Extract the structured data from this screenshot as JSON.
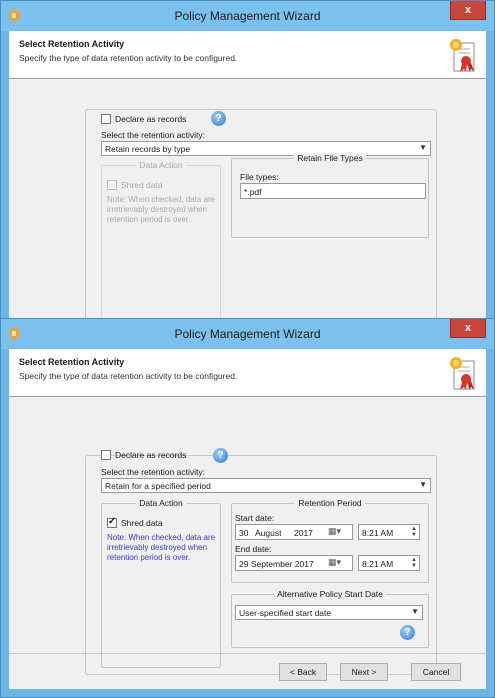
{
  "window1": {
    "title": "Policy Management Wizard",
    "close_glyph": "x",
    "header": {
      "title": "Select Retention Activity",
      "description": "Specify the type of data retention activity to be configured."
    },
    "declare_label": "Declare as records",
    "declare_checked": false,
    "select_label": "Select the retention activity:",
    "retention_activity": "Retain records by type",
    "data_action": {
      "title": "Data Action",
      "shred_label": "Shred data",
      "shred_checked": false,
      "note": "Note: When checked, data are irretrievably destroyed when retention period is over."
    },
    "file_types_group": {
      "title": "Retain File Types",
      "label": "File types:",
      "value": "*.pdf"
    }
  },
  "window2": {
    "title": "Policy Management Wizard",
    "close_glyph": "x",
    "header": {
      "title": "Select Retention Activity",
      "description": "Specify the type of data retention activity to be configured."
    },
    "declare_label": "Declare as records",
    "declare_checked": false,
    "select_label": "Select the retention activity:",
    "retention_activity": "Retain for a specified period",
    "data_action": {
      "title": "Data Action",
      "shred_label": "Shred data",
      "shred_checked": true,
      "note": "Note: When checked, data are irretrievably destroyed when retention period is over."
    },
    "retention_period": {
      "title": "Retention Period",
      "start_label": "Start date:",
      "start_day": "30",
      "start_month": "August",
      "start_year": "2017",
      "start_time": "8:21 AM",
      "end_label": "End date:",
      "end_date": "29 September 2017",
      "end_time": "8:21 AM"
    },
    "alt_start": {
      "title": "Alternative Policy Start Date",
      "value": "User-specified start date"
    },
    "buttons": {
      "back": "< Back",
      "next": "Next >",
      "cancel": "Cancel"
    }
  },
  "colors": {
    "title_bar": "#7cc1ee",
    "frame": "#6cb5e6",
    "close": "#c9463d",
    "note_text": "#3a3acb"
  },
  "icons": [
    "app-icon",
    "certificate-icon",
    "help-icon",
    "calendar-icon",
    "dropdown-arrow-icon",
    "spinner-icon"
  ]
}
